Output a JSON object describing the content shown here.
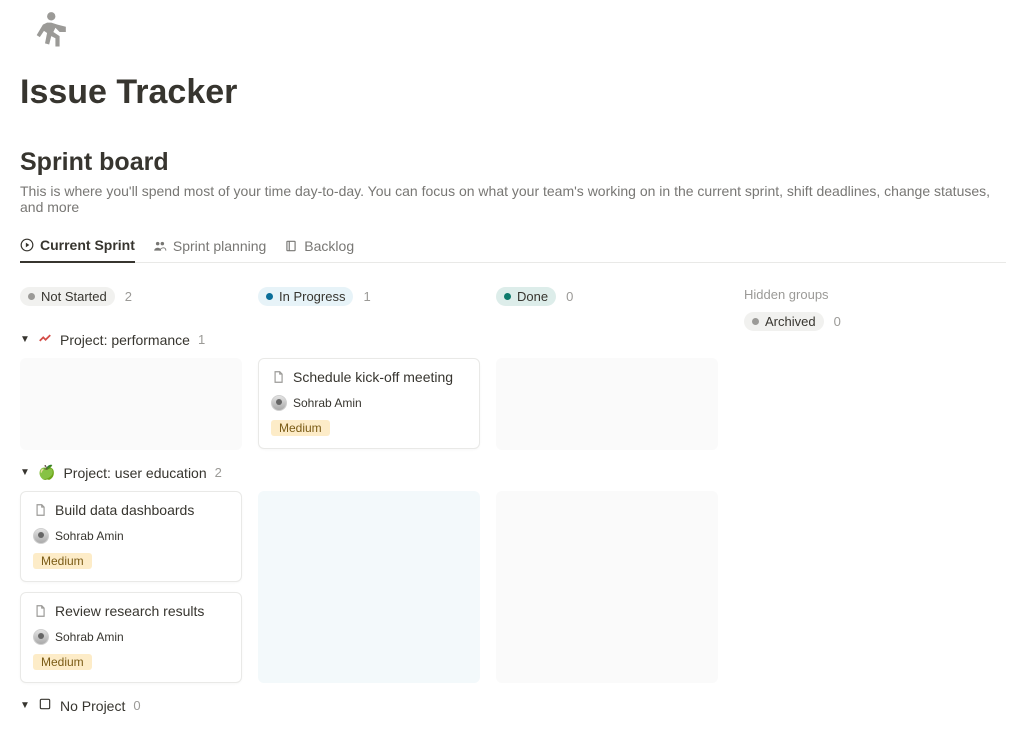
{
  "header": {
    "icon": "running-person-icon",
    "title": "Issue Tracker"
  },
  "section": {
    "title": "Sprint board",
    "description": "This is where you'll spend most of your time day-to-day. You can focus on what your team's working on in the current sprint, shift deadlines, change statuses, and more"
  },
  "tabs": [
    {
      "label": "Current Sprint",
      "icon": "play-circle-icon",
      "active": true
    },
    {
      "label": "Sprint planning",
      "icon": "people-icon",
      "active": false
    },
    {
      "label": "Backlog",
      "icon": "notebook-icon",
      "active": false
    }
  ],
  "columns": [
    {
      "label": "Not Started",
      "count": 2,
      "color": "gray"
    },
    {
      "label": "In Progress",
      "count": 1,
      "color": "blue"
    },
    {
      "label": "Done",
      "count": 0,
      "color": "green"
    }
  ],
  "hidden": {
    "title": "Hidden groups",
    "items": [
      {
        "label": "Archived",
        "count": 0,
        "color": "gray"
      }
    ]
  },
  "groups": [
    {
      "name": "Project: performance",
      "icon": "chart-upward-icon",
      "count": 1,
      "cards": {
        "Not Started": [],
        "In Progress": [
          {
            "title": "Schedule kick-off meeting",
            "assignee": "Sohrab Amin",
            "priority": "Medium"
          }
        ],
        "Done": []
      }
    },
    {
      "name": "Project: user education",
      "icon": "green-apple-icon",
      "count": 2,
      "cards": {
        "Not Started": [
          {
            "title": "Build data dashboards",
            "assignee": "Sohrab Amin",
            "priority": "Medium"
          },
          {
            "title": "Review research results",
            "assignee": "Sohrab Amin",
            "priority": "Medium"
          }
        ],
        "In Progress": [],
        "Done": []
      }
    },
    {
      "name": "No Project",
      "icon": "empty-box-icon",
      "count": 0,
      "cards": {
        "Not Started": [],
        "In Progress": [],
        "Done": []
      }
    }
  ],
  "priority_colors": {
    "Medium": "#fdecc8"
  }
}
